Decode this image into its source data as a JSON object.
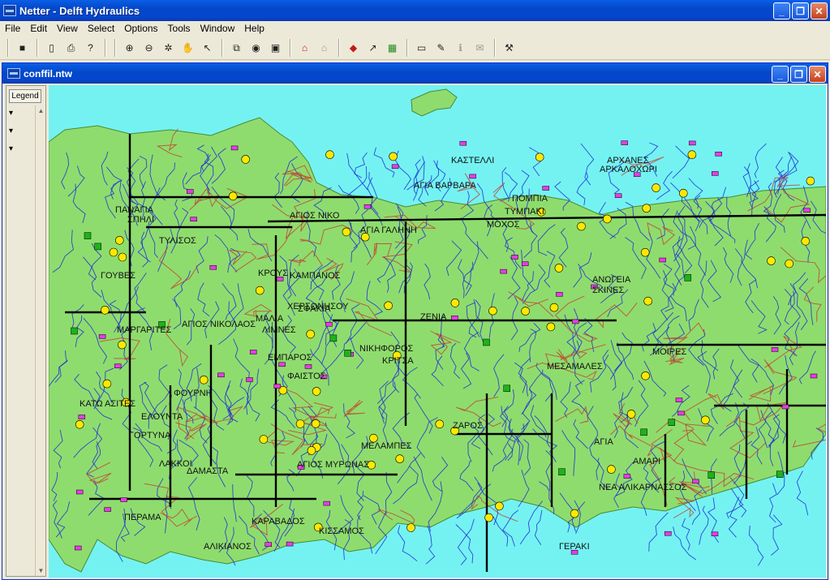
{
  "app": {
    "title": "Netter - Delft Hydraulics",
    "window_buttons": {
      "minimize": "_",
      "restore": "❐",
      "close": "✕"
    }
  },
  "menu": {
    "items": [
      "File",
      "Edit",
      "View",
      "Select",
      "Options",
      "Tools",
      "Window",
      "Help"
    ]
  },
  "toolbar": {
    "icons": [
      "save-icon",
      "new-icon",
      "print-icon",
      "help-icon",
      "zoom-in-icon",
      "zoom-out-icon",
      "zoom-extent-icon",
      "pan-hand-icon",
      "select-arrow-icon",
      "select-box-icon",
      "globe-icon",
      "fit-icon",
      "node-add-icon",
      "node-lock-icon",
      "edit-node-icon",
      "pointer-tool-icon",
      "map-icon",
      "image-icon",
      "tag-icon",
      "info-icon",
      "disabled-tool-icon",
      "edit-branch-icon"
    ]
  },
  "child_window": {
    "title": "conffil.ntw",
    "legend_button": "Legend",
    "legend_rows": [
      "▾",
      "▾",
      "▾"
    ]
  },
  "map": {
    "colors": {
      "sea": "#74f2f2",
      "land": "#8fdc6e",
      "rivers": "#1c2bd6",
      "roads": "#c23a2a",
      "network": "#000000",
      "node_yellow": "#ffe800",
      "node_magenta": "#e63ce6",
      "node_green": "#1ab41a"
    },
    "place_labels": [
      "ΚΙΣΣΑΜΟΣ",
      "ΑΓΙΑ",
      "ΣΚΙΝΕΣ",
      "ΔΑΜΑΣΤΑ",
      "ΑΛΙΚΙΑΝΟΣ",
      "ΝΕΑ ΑΛΙΚΑΡΝΑΣΣΟΣ",
      "ΧΕΡΣΟΝΗΣΟΥ",
      "ΑΓΙΟΣ ΝΙΚΟΛΑΟΣ",
      "ΚΡΟΥΣ",
      "ΜΑΛΙΑ",
      "ΝΙΚΗΦΟΡΟΣ",
      "ΛΙΜΝΕΣ",
      "ΕΛΟΥΝΤΑ",
      "ΖΕΝΙΑ",
      "ΜΟΧΟΣ",
      "ΑΓΙΟΣ ΝΙΚΟ",
      "ΚΡΙΤΣΑ",
      "ΓΕΡΑΚΙ",
      "ΠΑΝΑΓΙΑ",
      "ΕΜΠΑΡΟΣ",
      "ΜΕΣΑΜΑΛΕΣ",
      "ΚΑΣΤΕΛΛΙ",
      "ΓΟΥΒΕΣ",
      "ΠΕΡΑΜΑ",
      "ΣΠΗΛΙ",
      "ΚΑΜΠΑΝΟΣ",
      "ΤΥΜΠΑΚΙ",
      "ΜΟΙΡΕΣ",
      "ΖΑΡΟΣ",
      "ΑΡΚΑΛΟΧΩΡΙ",
      "ΑΓΙΑ ΒΑΡΒΑΡΑ",
      "ΓΟΡΤΥΝΑ",
      "ΑΓΙΑ ΓΑΛΗΝΗ",
      "ΛΑΚΚΟΙ",
      "ΣΦΑΚΙΑ",
      "ΑΝΩΓΕΙΑ",
      "ΤΥΛΙΣΟΣ",
      "ΦΑΙΣΤΟΣ",
      "ΠΟΜΠΙΑ",
      "ΜΕΛΑΜΠΕΣ",
      "ΑΡΧΑΝΕΣ",
      "ΜΑΡΓΑΡΙΤΕΣ",
      "ΑΓΙΟΣ ΜΥΡΩΝΑΣ",
      "ΑΜΑΡΙ",
      "ΚΑΡΑΒΑΔΟΣ",
      "ΦΟΥΡΝΗ",
      "ΚΑΤΩ ΑΣΙΤΕΣ"
    ]
  }
}
